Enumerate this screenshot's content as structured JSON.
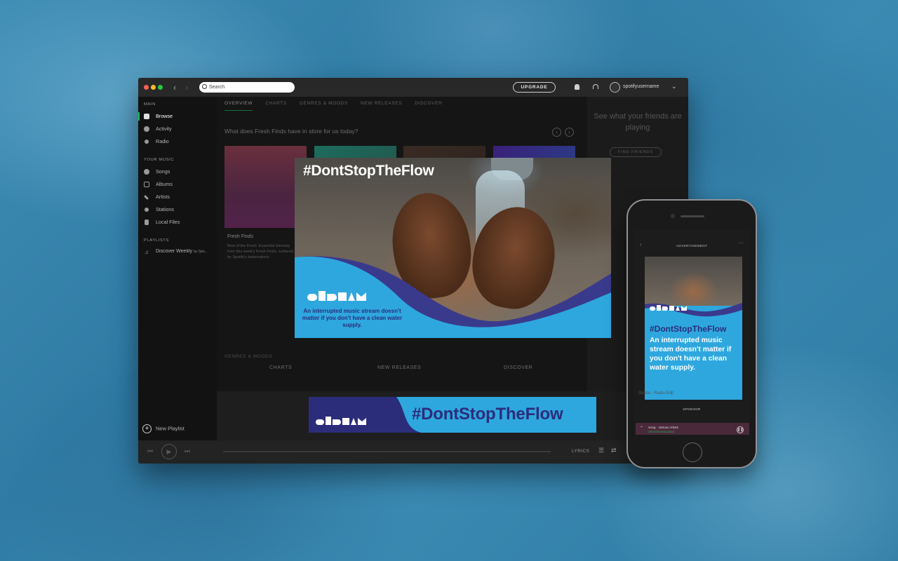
{
  "window": {
    "search_placeholder": "Search",
    "upgrade_label": "UPGRADE",
    "username": "spotifyusername"
  },
  "sidebar": {
    "main_label": "MAIN",
    "main_items": [
      {
        "label": "Browse",
        "active": true
      },
      {
        "label": "Activity"
      },
      {
        "label": "Radio"
      }
    ],
    "your_music_label": "YOUR MUSIC",
    "music_items": [
      {
        "label": "Songs"
      },
      {
        "label": "Albums"
      },
      {
        "label": "Artists"
      },
      {
        "label": "Stations"
      },
      {
        "label": "Local Files"
      }
    ],
    "playlists_label": "PLAYLISTS",
    "playlist_item": "Discover Weekly",
    "playlist_owner": "by Spo...",
    "new_playlist": "New Playlist"
  },
  "main": {
    "tabs": [
      "OVERVIEW",
      "CHARTS",
      "GENRES & MOODS",
      "NEW RELEASES",
      "DISCOVER"
    ],
    "headline": "What does Fresh Finds have in store for us today?",
    "tile_title": "Fresh Finds",
    "tile_desc": "Best of the Fresh. Essential listening from this week's Fresh Finds, surfaced by Spotify's tastemakers.",
    "categories": [
      "CHARTS",
      "NEW RELEASES",
      "DISCOVER"
    ],
    "genres_label": "GENRES & MOODS",
    "friends_text": "See what your friends are playing",
    "find_friends": "FIND FRIENDS"
  },
  "player": {
    "lyrics_label": "LYRICS"
  },
  "ad": {
    "hashtag": "#DontStopTheFlow",
    "copy": "An interrupted music stream doesn't matter if you don't have a clean water supply.",
    "banner_hashtag": "#DontStopTheFlow"
  },
  "phone": {
    "ad_label": "ADVERTISEMENT",
    "hashtag": "#DontStopTheFlow",
    "copy": "An interrupted music stream doesn't matter if you don't have a clean water supply.",
    "footer_label": "SPONSOR",
    "now_playing": "Song · Various Artists",
    "device_label": "DEVICES AVAILABLE",
    "side_text": "Simba - Radio Edit"
  },
  "colors": {
    "spotify_green": "#1db954",
    "ad_blue": "#2ea7df",
    "ad_navy": "#2b2d7a"
  }
}
